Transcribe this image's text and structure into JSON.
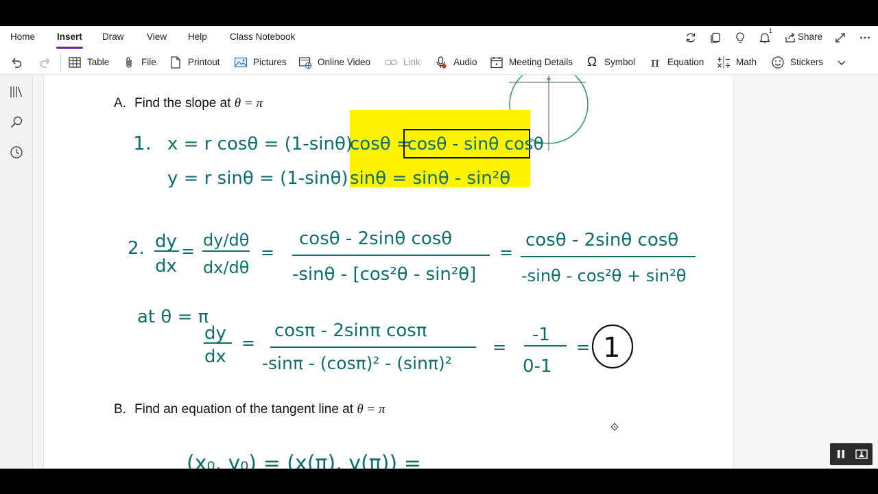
{
  "tabs": [
    {
      "label": "Home",
      "active": false
    },
    {
      "label": "Insert",
      "active": true
    },
    {
      "label": "Draw",
      "active": false
    },
    {
      "label": "View",
      "active": false
    },
    {
      "label": "Help",
      "active": false
    },
    {
      "label": "Class Notebook",
      "active": false
    }
  ],
  "top_right": {
    "notification_count": "1",
    "share_label": "Share",
    "icons": [
      "sync-icon",
      "copy-page-icon",
      "lightbulb-icon",
      "bell-icon",
      "share-icon",
      "expand-icon",
      "more-icon"
    ]
  },
  "ribbon": {
    "table": "Table",
    "file": "File",
    "printout": "Printout",
    "pictures": "Pictures",
    "online_video": "Online Video",
    "link": "Link",
    "audio": "Audio",
    "meeting_details": "Meeting Details",
    "symbol": "Symbol",
    "equation": "Equation",
    "math": "Math",
    "stickers": "Stickers"
  },
  "page": {
    "part_a": {
      "label": "A.",
      "text": "Find the slope at",
      "math": "θ = π"
    },
    "part_b": {
      "label": "B.",
      "text": "Find an equation of the tangent line at",
      "math": "θ = π"
    },
    "ink": {
      "step1_label": "1.",
      "step1_x": "x = r cosθ = (1-sinθ)",
      "step1_x_hl": "cosθ = ",
      "step1_x_boxed": "cosθ - sinθ cosθ",
      "step1_y": "y = r sinθ = (1-sinθ)",
      "step1_y_hl": "sinθ = sinθ - sin²θ",
      "step2_label": "2.",
      "dy": "dy",
      "dx": "dx",
      "dy_dtheta": "dy/dθ",
      "dx_dtheta": "dx/dθ",
      "eq": "=",
      "num1": "cosθ - 2sinθ cosθ",
      "den1": "-sinθ - [cos²θ - sin²θ]",
      "num2": "cosθ - 2sinθ cosθ",
      "den2": "-sinθ - cos²θ + sin²θ",
      "at_label": "at θ = π",
      "num3": "cosπ - 2sinπ cosπ",
      "den3": "-sinπ - (cosπ)² - (sinπ)²",
      "num4": "-1",
      "den4": "0-1",
      "answer": "1",
      "point": "(x₀, y₀) = (x(π), y(π)) ="
    }
  },
  "colors": {
    "accent": "#7719aa",
    "ink": "#0d6e6e",
    "highlight": "#fff200",
    "circle": "#2e9e6a"
  }
}
